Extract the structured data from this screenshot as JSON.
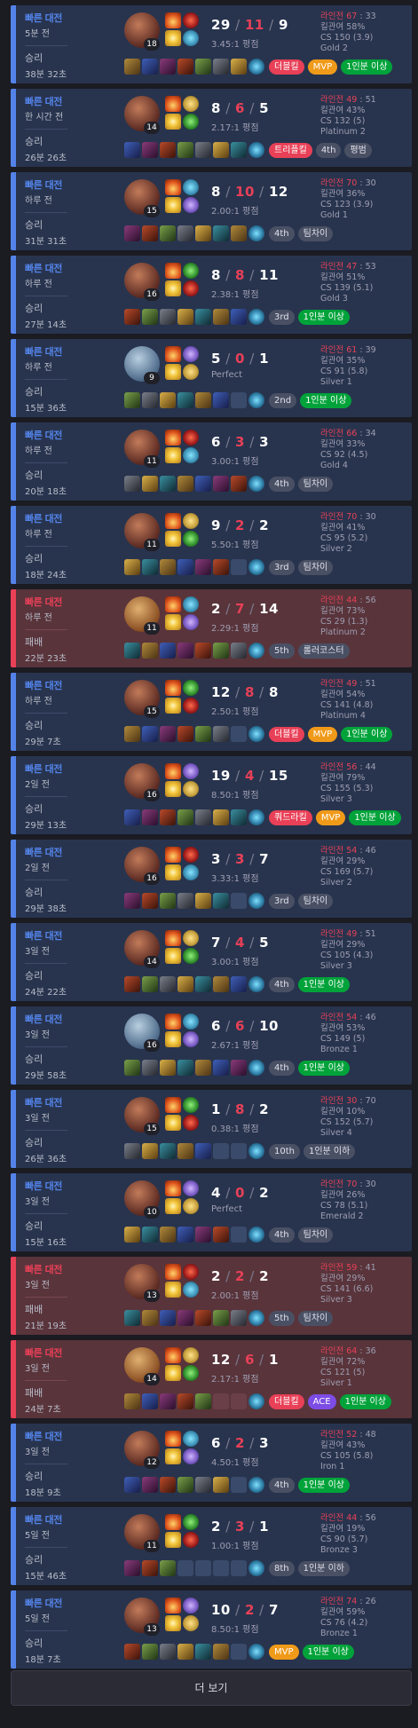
{
  "more_button": "더 보기",
  "matches": [
    {
      "queue": "빠른 대전",
      "ago": "5분 전",
      "result": "승리",
      "duration": "38분 32초",
      "level": "18",
      "kills": "29",
      "deaths": "11",
      "assists": "9",
      "ratio": "3.45:1 평점",
      "lane": "라인전 67",
      "lane_rival": "33",
      "kill_part": "킬관여 58%",
      "cs": "CS 150 (3.9)",
      "tier": "Gold 2",
      "badges": [
        {
          "text": "더블킬",
          "color": "red"
        },
        {
          "text": "MVP",
          "color": "orange"
        },
        {
          "text": "1인분 이상",
          "color": "green"
        }
      ],
      "items": 7,
      "win": true
    },
    {
      "queue": "빠른 대전",
      "ago": "한 시간 전",
      "result": "승리",
      "duration": "26분 26초",
      "level": "14",
      "kills": "8",
      "deaths": "6",
      "assists": "5",
      "ratio": "2.17:1 평점",
      "lane": "라인전 49",
      "lane_rival": "51",
      "kill_part": "킬관여 43%",
      "cs": "CS 132 (5)",
      "tier": "Platinum 2",
      "badges": [
        {
          "text": "트리플킬",
          "color": "red"
        },
        {
          "text": "4th",
          "color": "gray"
        },
        {
          "text": "평범",
          "color": "gray"
        }
      ],
      "items": 7,
      "win": true
    },
    {
      "queue": "빠른 대전",
      "ago": "하루 전",
      "result": "승리",
      "duration": "31분 31초",
      "level": "15",
      "kills": "8",
      "deaths": "10",
      "assists": "12",
      "ratio": "2.00:1 평점",
      "lane": "라인전 70",
      "lane_rival": "30",
      "kill_part": "킬관여 36%",
      "cs": "CS 123 (3.9)",
      "tier": "Gold 1",
      "badges": [
        {
          "text": "4th",
          "color": "gray"
        },
        {
          "text": "팀차이",
          "color": "gray"
        }
      ],
      "items": 7,
      "win": true
    },
    {
      "queue": "빠른 대전",
      "ago": "하루 전",
      "result": "승리",
      "duration": "27분 14초",
      "level": "16",
      "kills": "8",
      "deaths": "8",
      "assists": "11",
      "ratio": "2.38:1 평점",
      "lane": "라인전 47",
      "lane_rival": "53",
      "kill_part": "킬관여 51%",
      "cs": "CS 139 (5.1)",
      "tier": "Gold 3",
      "badges": [
        {
          "text": "3rd",
          "color": "gray"
        },
        {
          "text": "1인분 이상",
          "color": "green"
        }
      ],
      "items": 7,
      "win": true
    },
    {
      "queue": "빠른 대전",
      "ago": "하루 전",
      "result": "승리",
      "duration": "15분 36초",
      "level": "9",
      "kills": "5",
      "deaths": "0",
      "assists": "1",
      "ratio": "Perfect",
      "lane": "라인전 61",
      "lane_rival": "39",
      "kill_part": "킬관여 35%",
      "cs": "CS 91 (5.8)",
      "tier": "Silver 1",
      "badges": [
        {
          "text": "2nd",
          "color": "gray"
        },
        {
          "text": "1인분 이상",
          "color": "green"
        }
      ],
      "items": 6,
      "win": true
    },
    {
      "queue": "빠른 대전",
      "ago": "하루 전",
      "result": "승리",
      "duration": "20분 18초",
      "level": "11",
      "kills": "6",
      "deaths": "3",
      "assists": "3",
      "ratio": "3.00:1 평점",
      "lane": "라인전 66",
      "lane_rival": "34",
      "kill_part": "킬관여 33%",
      "cs": "CS 92 (4.5)",
      "tier": "Gold 4",
      "badges": [
        {
          "text": "4th",
          "color": "gray"
        },
        {
          "text": "팀차이",
          "color": "gray"
        }
      ],
      "items": 7,
      "win": true
    },
    {
      "queue": "빠른 대전",
      "ago": "하루 전",
      "result": "승리",
      "duration": "18분 24초",
      "level": "11",
      "kills": "9",
      "deaths": "2",
      "assists": "2",
      "ratio": "5.50:1 평점",
      "lane": "라인전 70",
      "lane_rival": "30",
      "kill_part": "킬관여 41%",
      "cs": "CS 95 (5.2)",
      "tier": "Silver 2",
      "badges": [
        {
          "text": "3rd",
          "color": "gray"
        },
        {
          "text": "팀차이",
          "color": "gray"
        }
      ],
      "items": 6,
      "win": true
    },
    {
      "queue": "빠른 대전",
      "ago": "하루 전",
      "result": "패배",
      "duration": "22분 23초",
      "level": "11",
      "kills": "2",
      "deaths": "7",
      "assists": "14",
      "ratio": "2.29:1 평점",
      "lane": "라인전 44",
      "lane_rival": "56",
      "kill_part": "킬관여 73%",
      "cs": "CS 29 (1.3)",
      "tier": "Platinum 2",
      "badges": [
        {
          "text": "5th",
          "color": "gray"
        },
        {
          "text": "롤러코스터",
          "color": "gray"
        }
      ],
      "items": 7,
      "win": false
    },
    {
      "queue": "빠른 대전",
      "ago": "하루 전",
      "result": "승리",
      "duration": "29분 7초",
      "level": "15",
      "kills": "12",
      "deaths": "8",
      "assists": "8",
      "ratio": "2.50:1 평점",
      "lane": "라인전 49",
      "lane_rival": "51",
      "kill_part": "킬관여 54%",
      "cs": "CS 141 (4.8)",
      "tier": "Platinum 4",
      "badges": [
        {
          "text": "더블킬",
          "color": "red"
        },
        {
          "text": "MVP",
          "color": "orange"
        },
        {
          "text": "1인분 이상",
          "color": "green"
        }
      ],
      "items": 6,
      "win": true
    },
    {
      "queue": "빠른 대전",
      "ago": "2일 전",
      "result": "승리",
      "duration": "29분 13초",
      "level": "16",
      "kills": "19",
      "deaths": "4",
      "assists": "15",
      "ratio": "8.50:1 평점",
      "lane": "라인전 56",
      "lane_rival": "44",
      "kill_part": "킬관여 79%",
      "cs": "CS 155 (5.3)",
      "tier": "Silver 3",
      "badges": [
        {
          "text": "쿼드라킬",
          "color": "red"
        },
        {
          "text": "MVP",
          "color": "orange"
        },
        {
          "text": "1인분 이상",
          "color": "green"
        }
      ],
      "items": 7,
      "win": true
    },
    {
      "queue": "빠른 대전",
      "ago": "2일 전",
      "result": "승리",
      "duration": "29분 38초",
      "level": "16",
      "kills": "3",
      "deaths": "3",
      "assists": "7",
      "ratio": "3.33:1 평점",
      "lane": "라인전 54",
      "lane_rival": "46",
      "kill_part": "킬관여 29%",
      "cs": "CS 169 (5.7)",
      "tier": "Silver 2",
      "badges": [
        {
          "text": "3rd",
          "color": "gray"
        },
        {
          "text": "팀차이",
          "color": "gray"
        }
      ],
      "items": 6,
      "win": true
    },
    {
      "queue": "빠른 대전",
      "ago": "3일 전",
      "result": "승리",
      "duration": "24분 22초",
      "level": "14",
      "kills": "7",
      "deaths": "4",
      "assists": "5",
      "ratio": "3.00:1 평점",
      "lane": "라인전 49",
      "lane_rival": "51",
      "kill_part": "킬관여 29%",
      "cs": "CS 105 (4.3)",
      "tier": "Silver 3",
      "badges": [
        {
          "text": "4th",
          "color": "gray"
        },
        {
          "text": "1인분 이상",
          "color": "green"
        }
      ],
      "items": 7,
      "win": true
    },
    {
      "queue": "빠른 대전",
      "ago": "3일 전",
      "result": "승리",
      "duration": "29분 58초",
      "level": "16",
      "kills": "6",
      "deaths": "6",
      "assists": "10",
      "ratio": "2.67:1 평점",
      "lane": "라인전 54",
      "lane_rival": "46",
      "kill_part": "킬관여 53%",
      "cs": "CS 149 (5)",
      "tier": "Bronze 1",
      "badges": [
        {
          "text": "4th",
          "color": "gray"
        },
        {
          "text": "1인분 이상",
          "color": "green"
        }
      ],
      "items": 7,
      "win": true
    },
    {
      "queue": "빠른 대전",
      "ago": "3일 전",
      "result": "승리",
      "duration": "26분 36초",
      "level": "15",
      "kills": "1",
      "deaths": "8",
      "assists": "2",
      "ratio": "0.38:1 평점",
      "lane": "라인전 30",
      "lane_rival": "70",
      "kill_part": "킬관여 10%",
      "cs": "CS 152 (5.7)",
      "tier": "Silver 4",
      "badges": [
        {
          "text": "10th",
          "color": "gray"
        },
        {
          "text": "1인분 이하",
          "color": "gray"
        }
      ],
      "items": 5,
      "win": true
    },
    {
      "queue": "빠른 대전",
      "ago": "3일 전",
      "result": "승리",
      "duration": "15분 16초",
      "level": "10",
      "kills": "4",
      "deaths": "0",
      "assists": "2",
      "ratio": "Perfect",
      "lane": "라인전 70",
      "lane_rival": "30",
      "kill_part": "킬관여 26%",
      "cs": "CS 78 (5.1)",
      "tier": "Emerald 2",
      "badges": [
        {
          "text": "4th",
          "color": "gray"
        },
        {
          "text": "팀차이",
          "color": "gray"
        }
      ],
      "items": 6,
      "win": true
    },
    {
      "queue": "빠른 대전",
      "ago": "3일 전",
      "result": "패배",
      "duration": "21분 19초",
      "level": "13",
      "kills": "2",
      "deaths": "2",
      "assists": "2",
      "ratio": "2.00:1 평점",
      "lane": "라인전 59",
      "lane_rival": "41",
      "kill_part": "킬관여 29%",
      "cs": "CS 141 (6.6)",
      "tier": "Silver 3",
      "badges": [
        {
          "text": "5th",
          "color": "gray"
        },
        {
          "text": "팀차이",
          "color": "gray"
        }
      ],
      "items": 7,
      "win": false
    },
    {
      "queue": "빠른 대전",
      "ago": "3일 전",
      "result": "패배",
      "duration": "24분 7초",
      "level": "14",
      "kills": "12",
      "deaths": "6",
      "assists": "1",
      "ratio": "2.17:1 평점",
      "lane": "라인전 64",
      "lane_rival": "36",
      "kill_part": "킬관여 72%",
      "cs": "CS 121 (5)",
      "tier": "Silver 1",
      "badges": [
        {
          "text": "더블킬",
          "color": "red"
        },
        {
          "text": "ACE",
          "color": "purple"
        },
        {
          "text": "1인분 이상",
          "color": "green"
        }
      ],
      "items": 5,
      "win": false
    },
    {
      "queue": "빠른 대전",
      "ago": "3일 전",
      "result": "승리",
      "duration": "18분 9초",
      "level": "12",
      "kills": "6",
      "deaths": "2",
      "assists": "3",
      "ratio": "4.50:1 평점",
      "lane": "라인전 52",
      "lane_rival": "48",
      "kill_part": "킬관여 43%",
      "cs": "CS 105 (5.8)",
      "tier": "Iron 1",
      "badges": [
        {
          "text": "4th",
          "color": "gray"
        },
        {
          "text": "1인분 이상",
          "color": "green"
        }
      ],
      "items": 6,
      "win": true
    },
    {
      "queue": "빠른 대전",
      "ago": "5일 전",
      "result": "승리",
      "duration": "15분 46초",
      "level": "11",
      "kills": "2",
      "deaths": "3",
      "assists": "1",
      "ratio": "1.00:1 평점",
      "lane": "라인전 44",
      "lane_rival": "56",
      "kill_part": "킬관여 19%",
      "cs": "CS 90 (5.7)",
      "tier": "Bronze 3",
      "badges": [
        {
          "text": "8th",
          "color": "gray"
        },
        {
          "text": "1인분 이하",
          "color": "gray"
        }
      ],
      "items": 3,
      "win": true
    },
    {
      "queue": "빠른 대전",
      "ago": "5일 전",
      "result": "승리",
      "duration": "18분 7초",
      "level": "13",
      "kills": "10",
      "deaths": "2",
      "assists": "7",
      "ratio": "8.50:1 평점",
      "lane": "라인전 74",
      "lane_rival": "26",
      "kill_part": "킬관여 59%",
      "cs": "CS 76 (4.2)",
      "tier": "Bronze 1",
      "badges": [
        {
          "text": "MVP",
          "color": "orange"
        },
        {
          "text": "1인분 이상",
          "color": "green"
        }
      ],
      "items": 6,
      "win": true
    }
  ]
}
